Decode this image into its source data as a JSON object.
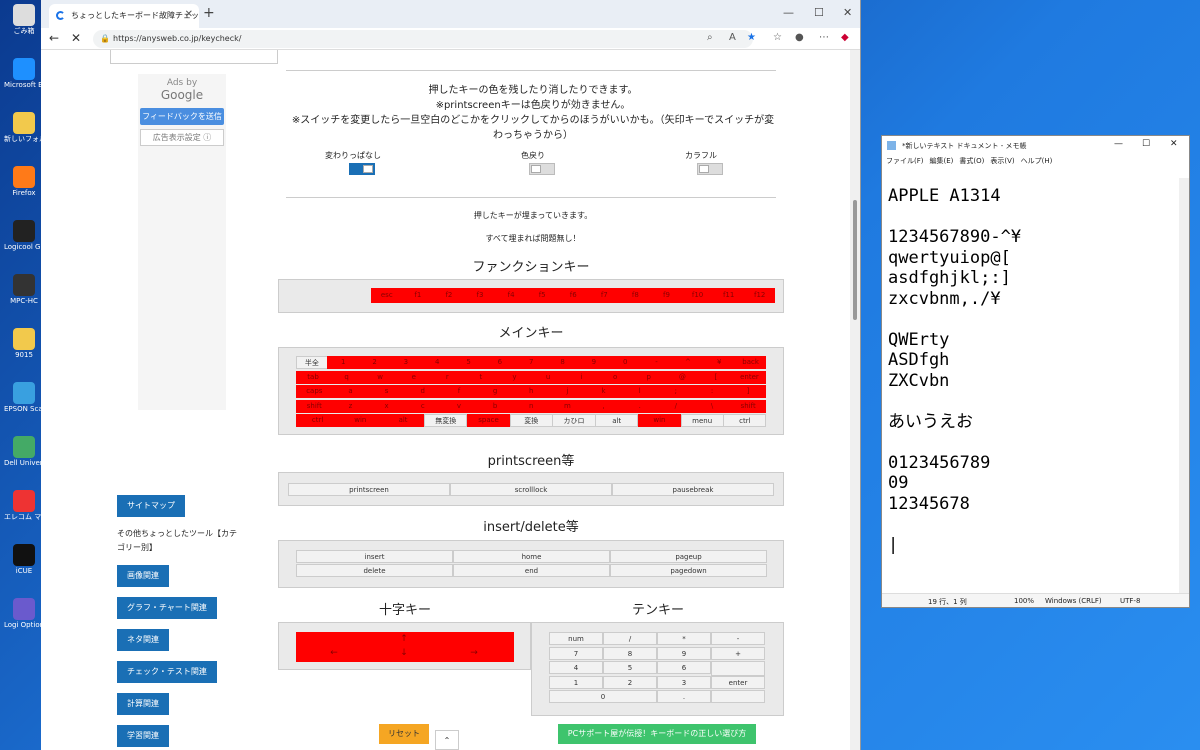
{
  "desktop": {
    "icons": [
      "ごみ箱",
      "Microsoft Edge",
      "新しいフォルダー",
      "Firefox",
      "Logicool G HUB",
      "MPC-HC",
      "9015",
      "EPSON Scan",
      "Dell Universal Receiver Control",
      "エレコム マウスアシスタント",
      "iCUE",
      "Logi Options+"
    ]
  },
  "browser": {
    "tab_title": "ちょっとしたキーボード故障チェック・テスト",
    "url": "https://anysweb.co.jp/keycheck/",
    "ads": {
      "ads_by": "Ads by",
      "google": "Google",
      "feedback": "フィードバックを送信",
      "settings": "広告表示設定 ⓘ"
    },
    "intro": {
      "line1": "押したキーの色を残したり消したりできます。",
      "line2": "※printscreenキーは色戻りが効きません。",
      "line3": "※スイッチを変更したら一旦空白のどこかをクリックしてからのほうがいいかも。（矢印キーでスイッチが変わっちゃうから）"
    },
    "switches": [
      {
        "label": "変わりっぱなし",
        "on": true
      },
      {
        "label": "色戻り",
        "on": false
      },
      {
        "label": "カラフル",
        "on": false
      }
    ],
    "note1": "押したキーが埋まっていきます。",
    "note2": "すべて埋まれば問題無し！",
    "function_title": "ファンクションキー",
    "function_keys": [
      "esc",
      "f1",
      "f2",
      "f3",
      "f4",
      "f5",
      "f6",
      "f7",
      "f8",
      "f9",
      "f10",
      "f11",
      "f12"
    ],
    "main_title": "メインキー",
    "main_rows": [
      [
        "半全",
        "1",
        "2",
        "3",
        "4",
        "5",
        "6",
        "7",
        "8",
        "9",
        "0",
        "-",
        "^",
        "¥",
        "back"
      ],
      [
        "tab",
        "q",
        "w",
        "e",
        "r",
        "t",
        "y",
        "u",
        "i",
        "o",
        "p",
        "@",
        "[",
        "enter"
      ],
      [
        "caps",
        "a",
        "s",
        "d",
        "f",
        "g",
        "h",
        "j",
        "k",
        "l",
        ";",
        ":",
        "]"
      ],
      [
        "shift",
        "z",
        "x",
        "c",
        "v",
        "b",
        "n",
        "m",
        ",",
        ".",
        "/",
        "\\",
        "shift"
      ],
      [
        "ctrl",
        "win",
        "alt",
        "無変換",
        "space",
        "変換",
        "カひロ",
        "alt",
        "win",
        "menu",
        "ctrl"
      ]
    ],
    "print_title": "printscreen等",
    "print_keys": [
      "printscreen",
      "scrolllock",
      "pausebreak"
    ],
    "insert_title": "insert/delete等",
    "insert_keys": [
      [
        "insert",
        "home",
        "pageup"
      ],
      [
        "delete",
        "end",
        "pagedown"
      ]
    ],
    "arrow_title": "十字キー",
    "arrow_keys": [
      "↑",
      "←",
      "↓",
      "→"
    ],
    "tenkey_title": "テンキー",
    "tenkey": [
      [
        "num",
        "/",
        "*",
        "-"
      ],
      [
        "7",
        "8",
        "9",
        "+"
      ],
      [
        "4",
        "5",
        "6",
        ""
      ],
      [
        "1",
        "2",
        "3",
        "enter"
      ],
      [
        "0",
        ".",
        "",
        ""
      ]
    ],
    "sidebar": {
      "sitemap": "サイトマップ",
      "other_tools": "その他ちょっとしたツール【カテゴリー別】",
      "categories": [
        "画像関連",
        "グラフ・チャート関連",
        "ネタ関連",
        "チェック・テスト関連",
        "計算関連",
        "学習関連"
      ]
    },
    "reset": "リセット",
    "pc_support": "PCサポート屋が伝授！キーボードの正しい選び方"
  },
  "notepad": {
    "title": "*新しいテキスト ドキュメント - メモ帳",
    "menu": [
      "ファイル(F)",
      "編集(E)",
      "書式(O)",
      "表示(V)",
      "ヘルプ(H)"
    ],
    "content": "APPLE A1314\n\n1234567890-^¥\nqwertyuiop@[\nasdfghjkl;:]\nzxcvbnm,./¥\n\nQWErty\nASDfgh\nZXCvbn\n\nあいうえお\n\n0123456789\n09\n12345678\n\n|",
    "status": {
      "pos": "19 行、1 列",
      "zoom": "100%",
      "eol": "Windows (CRLF)",
      "enc": "UTF-8"
    }
  }
}
